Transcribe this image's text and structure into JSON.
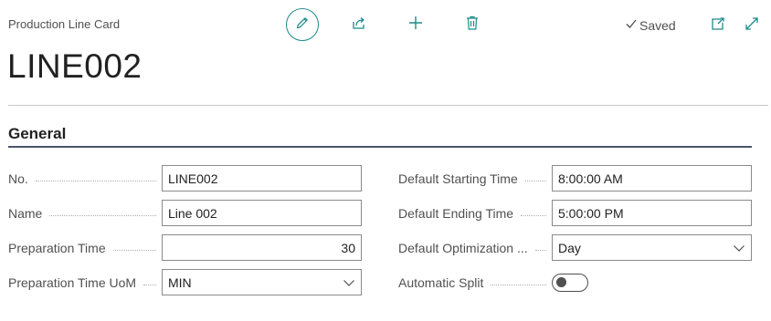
{
  "page": {
    "caption": "Production Line Card",
    "title": "LINE002",
    "status": "Saved"
  },
  "toolbar": {
    "edit_icon": "pencil-icon",
    "share_icon": "share-icon",
    "new_icon": "plus-icon",
    "delete_icon": "trash-icon",
    "open_new_window_icon": "open-in-new-window-icon",
    "expand_icon": "expand-icon"
  },
  "section": {
    "title": "General"
  },
  "fields": {
    "no": {
      "label": "No.",
      "value": "LINE002"
    },
    "name": {
      "label": "Name",
      "value": "Line 002"
    },
    "prep_time": {
      "label": "Preparation Time",
      "value": "30"
    },
    "prep_uom": {
      "label": "Preparation Time UoM",
      "value": "MIN"
    },
    "start_time": {
      "label": "Default Starting Time",
      "value": "8:00:00 AM"
    },
    "end_time": {
      "label": "Default Ending Time",
      "value": "5:00:00 PM"
    },
    "optimization": {
      "label": "Default Optimization ...",
      "value": "Day"
    },
    "auto_split": {
      "label": "Automatic Split",
      "value": "Off"
    }
  },
  "colors": {
    "accent": "#1f8a8a",
    "text": "#212121",
    "muted": "#505050",
    "border": "#8a8a8a"
  }
}
